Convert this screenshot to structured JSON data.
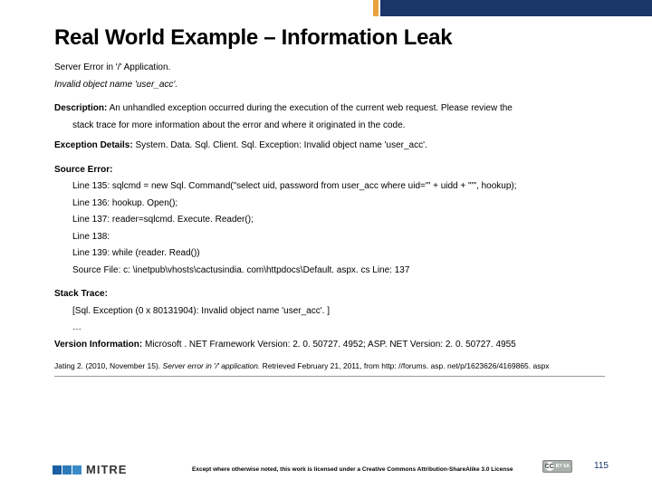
{
  "title": "Real World Example – Information Leak",
  "err": {
    "server_line": "Server Error in '/' Application.",
    "invalid": "Invalid object name 'user_acc'.",
    "desc_label": "Description:",
    "desc_text": " An unhandled exception occurred during the execution of the current web request. Please review the",
    "desc_text2": "stack trace for more information about the error and where it originated in the code.",
    "ed_label": "Exception Details:",
    "ed_text": " System. Data. Sql. Client. Sql. Exception: Invalid object name 'user_acc'.",
    "se_label": "Source Error:",
    "lines": {
      "l135": "Line 135: sqlcmd = new Sql. Command(\"select uid, password from user_acc where uid='\" + uidd + \"'\", hookup);",
      "l136": "Line 136: hookup. Open();",
      "l137": "Line 137: reader=sqlcmd. Execute. Reader();",
      "l138": "Line 138:",
      "l139": "Line 139: while (reader. Read())",
      "src": "Source File: c: \\inetpub\\vhosts\\cactusindia. com\\httpdocs\\Default. aspx. cs     Line:  137"
    },
    "st_label": "Stack Trace:",
    "st1": "[Sql. Exception (0 x 80131904): Invalid object name 'user_acc'. ]",
    "st2": "…",
    "vi_label": "Version Information:",
    "vi_text": " Microsoft . NET Framework Version: 2. 0. 50727. 4952; ASP. NET Version: 2. 0. 50727. 4955"
  },
  "citation": {
    "author": "Jating 2. (2010, November 15). ",
    "title_italic": "Server error in '/' application.",
    "rest": " Retrieved February 21, 2011, from http: //forums. asp. net/p/1623626/4169865. aspx"
  },
  "footer": {
    "logo_text": "MITRE",
    "license": "Except where otherwise noted, this work is licensed under a Creative Commons Attribution-ShareAlike 3.0 License",
    "cc_label": "CC",
    "cc_sub1": "BY  SA",
    "page_number": "115"
  }
}
